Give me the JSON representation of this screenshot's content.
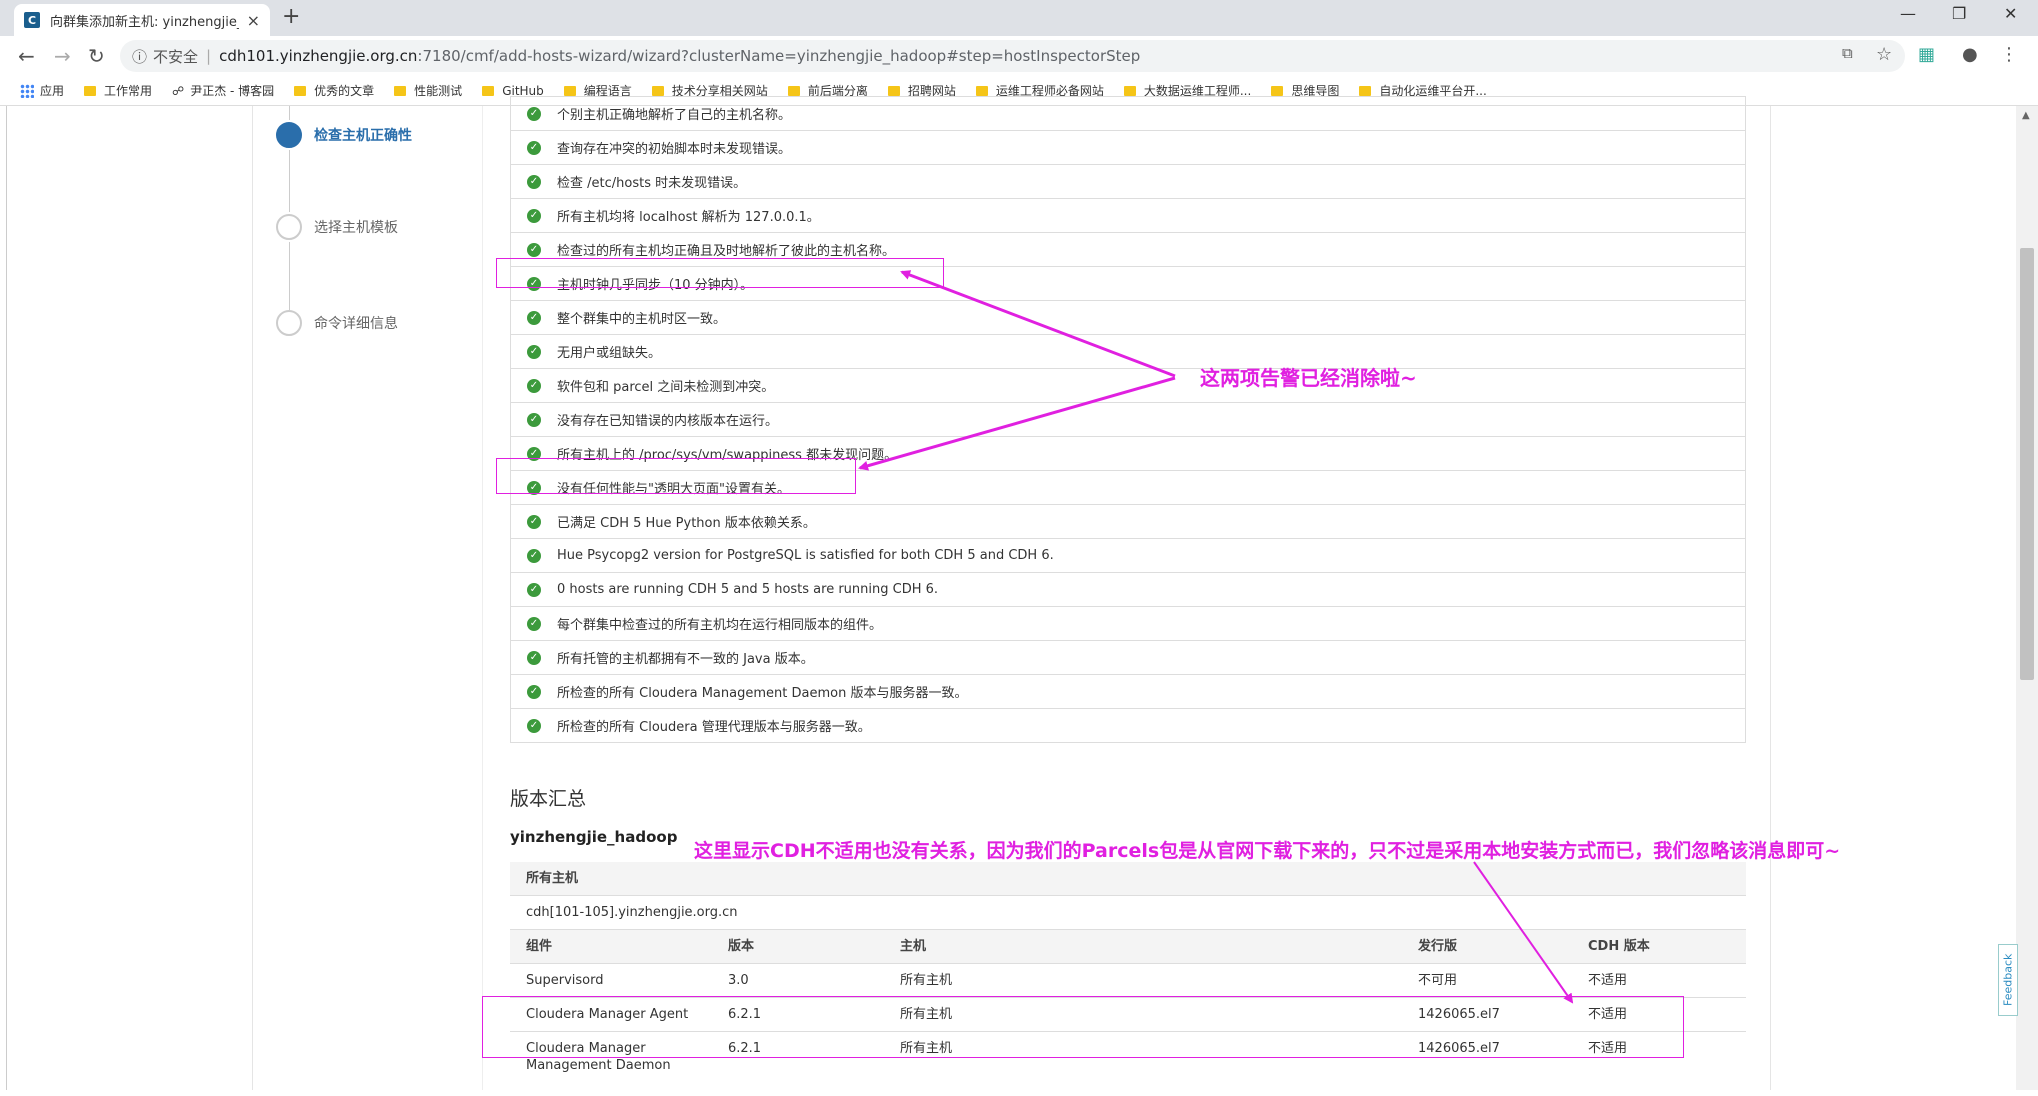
{
  "browser": {
    "tab_title": "向群集添加新主机: yinzhengjie_",
    "tab_favicon": "C",
    "insecure_label": "不安全",
    "url_host": "cdh101.yinzhengjie.org.cn",
    "url_path": ":7180/cmf/add-hosts-wizard/wizard?clusterName=yinzhengjie_hadoop#step=hostInspectorStep",
    "bookmarks": [
      "应用",
      "工作常用",
      "尹正杰 - 博客园",
      "优秀的文章",
      "性能测试",
      "GitHub",
      "编程语言",
      "技术分享相关网站",
      "前后端分离",
      "招聘网站",
      "运维工程师必备网站",
      "大数据运维工程师...",
      "思维导图",
      "自动化运维平台开..."
    ]
  },
  "steps": [
    {
      "label": "检查主机正确性",
      "active": true
    },
    {
      "label": "选择主机模板",
      "active": false
    },
    {
      "label": "命令详细信息",
      "active": false
    }
  ],
  "checks": [
    "个别主机正确地解析了自己的主机名称。",
    "查询存在冲突的初始脚本时未发现错误。",
    "检查 /etc/hosts 时未发现错误。",
    "所有主机均将 localhost 解析为 127.0.0.1。",
    "检查过的所有主机均正确且及时地解析了彼此的主机名称。",
    "主机时钟几乎同步（10 分钟内）。",
    "整个群集中的主机时区一致。",
    "无用户或组缺失。",
    "软件包和 parcel 之间未检测到冲突。",
    "没有存在已知错误的内核版本在运行。",
    "所有主机上的 /proc/sys/vm/swappiness 都未发现问题。",
    "没有任何性能与\"透明大页面\"设置有关。",
    "已满足 CDH 5 Hue Python 版本依赖关系。",
    "Hue Psycopg2 version for PostgreSQL is satisfied for both CDH 5 and CDH 6.",
    "0 hosts are running CDH 5 and 5 hosts are running CDH 6.",
    "每个群集中检查过的所有主机均在运行相同版本的组件。",
    "所有托管的主机都拥有不一致的 Java 版本。",
    "所检查的所有 Cloudera Management Daemon 版本与服务器一致。",
    "所检查的所有 Cloudera 管理代理版本与服务器一致。"
  ],
  "version_summary": {
    "title": "版本汇总",
    "cluster": "yinzhengjie_hadoop",
    "all_hosts_label": "所有主机",
    "hosts_range": "cdh[101-105].yinzhengjie.org.cn",
    "headers": [
      "组件",
      "版本",
      "主机",
      "发行版",
      "CDH 版本"
    ],
    "rows": [
      [
        "Supervisord",
        "3.0",
        "所有主机",
        "不可用",
        "不适用"
      ],
      [
        "Cloudera Manager Agent",
        "6.2.1",
        "所有主机",
        "1426065.el7",
        "不适用"
      ],
      [
        "Cloudera Manager",
        "6.2.1",
        "所有主机",
        "1426065.el7",
        "不适用"
      ]
    ],
    "overflow_text": "Management Daemon"
  },
  "annotations": {
    "warnings_cleared": "这两项告警已经消除啦~",
    "cdh_note": "这里显示CDH不适用也没有关系，因为我们的Parcels包是从官网下载下来的，只不过是采用本地安装方式而已，我们忽略该消息即可~"
  },
  "feedback_label": "Feedback",
  "colors": {
    "annotation": "#e020e0",
    "active_step": "#2a6eab",
    "check_ok": "#3c9a3c"
  }
}
